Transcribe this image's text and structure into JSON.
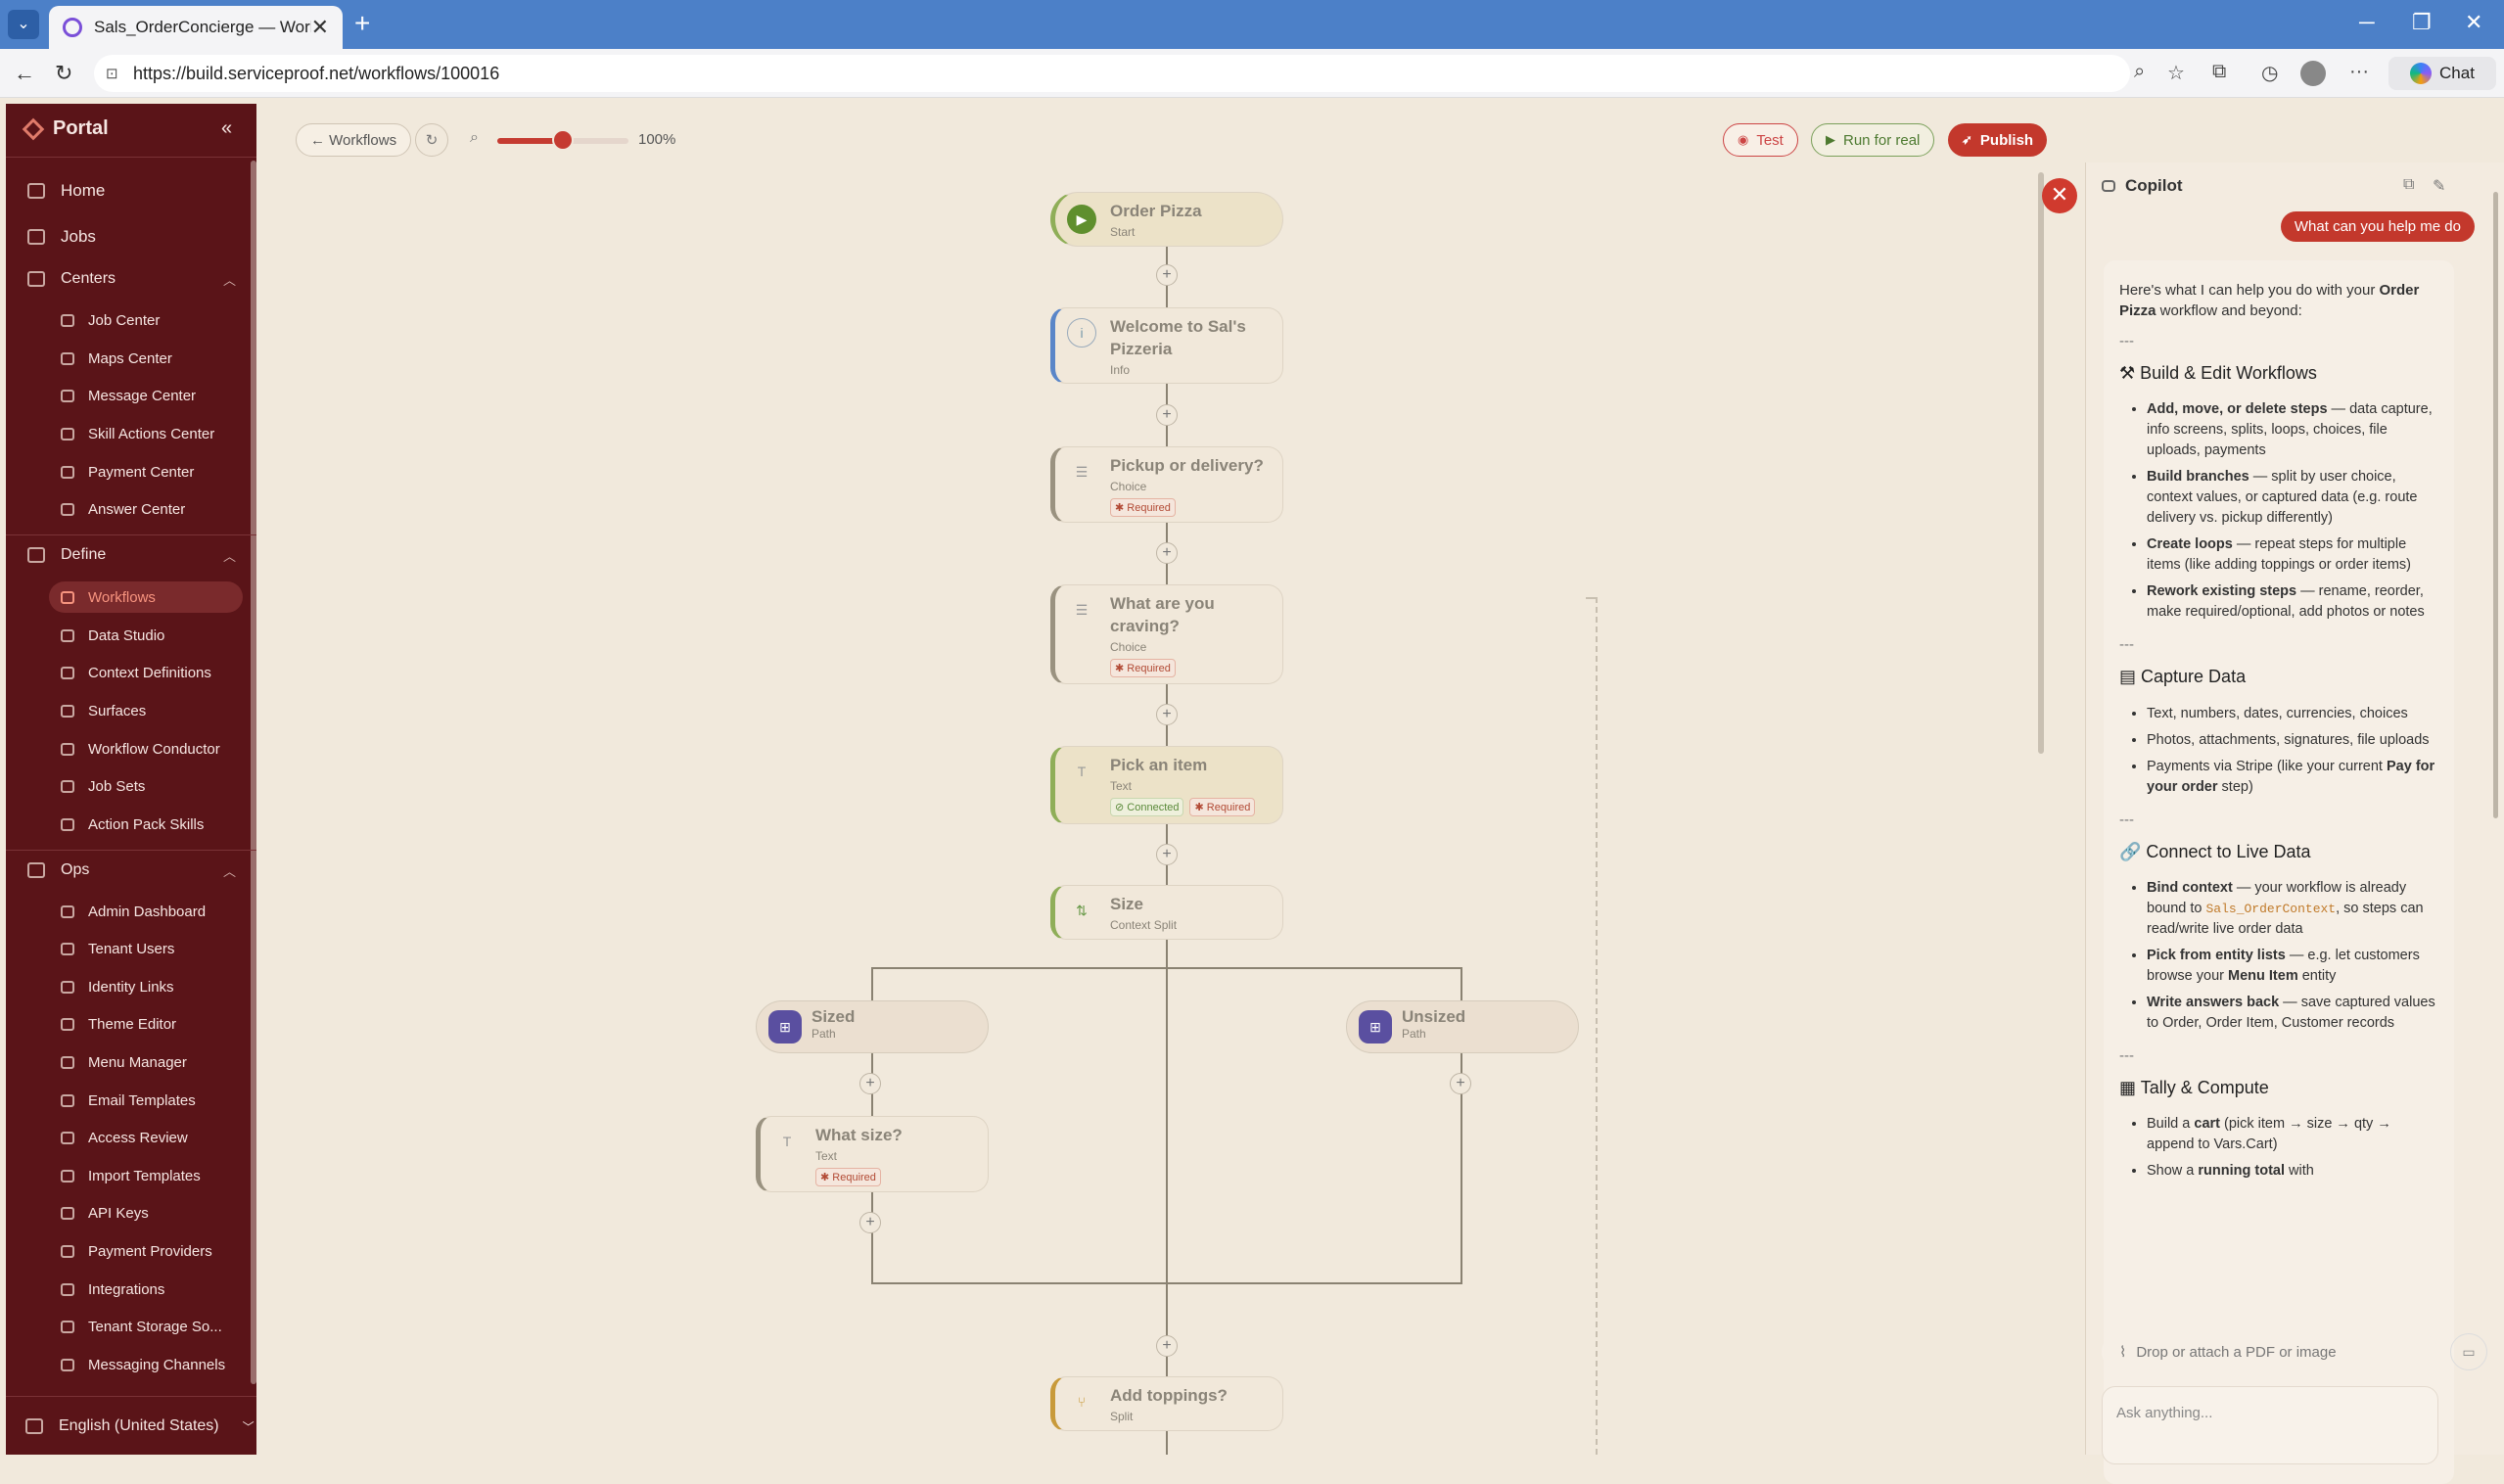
{
  "browser": {
    "tab_title": "Sals_OrderConcierge — Workflow",
    "url": "https://build.serviceproof.net/workflows/100016",
    "chat_label": "Chat"
  },
  "sidebar": {
    "brand": "Portal",
    "top_items": [
      {
        "label": "Home",
        "icon": "home-icon"
      },
      {
        "label": "Jobs",
        "icon": "briefcase-icon"
      }
    ],
    "sections": [
      {
        "label": "Centers",
        "icon": "grid-icon",
        "items": [
          "Job Center",
          "Maps Center",
          "Message Center",
          "Skill Actions Center",
          "Payment Center",
          "Answer Center"
        ]
      },
      {
        "label": "Define",
        "icon": "edit-icon",
        "items": [
          "Workflows",
          "Data Studio",
          "Context Definitions",
          "Surfaces",
          "Workflow Conductor",
          "Job Sets",
          "Action Pack Skills"
        ]
      },
      {
        "label": "Ops",
        "icon": "gear-icon",
        "items": [
          "Admin Dashboard",
          "Tenant Users",
          "Identity Links",
          "Theme Editor",
          "Menu Manager",
          "Email Templates",
          "Access Review",
          "Import Templates",
          "API Keys",
          "Payment Providers",
          "Integrations",
          "Tenant Storage So...",
          "Messaging Channels"
        ]
      }
    ],
    "active_item": "Workflows",
    "language": "English (United States)"
  },
  "toolbar": {
    "back_label": "← Workflows",
    "zoom_value": "100%",
    "zoom_fraction": 0.5,
    "test_label": "Test",
    "run_label": "Run for real",
    "publish_label": "Publish"
  },
  "flow": {
    "nodes": [
      {
        "title": "Order Pizza",
        "subtitle": "Start",
        "icon": "play-icon",
        "color": "#5f8f2e"
      },
      {
        "title": "Welcome to Sal's Pizzeria",
        "subtitle": "Info",
        "icon": "info-icon",
        "color": "#5a86c8"
      },
      {
        "title": "Pickup or delivery?",
        "subtitle": "Choice",
        "icon": "list-icon",
        "badges": [
          "Required"
        ]
      },
      {
        "title": "What are you craving?",
        "subtitle": "Choice",
        "icon": "list-icon",
        "badges": [
          "Required"
        ]
      },
      {
        "title": "Pick an item",
        "subtitle": "Text",
        "icon": "text-icon",
        "badges": [
          "Connected",
          "Required"
        ]
      },
      {
        "title": "Size",
        "subtitle": "Context Split",
        "icon": "split-icon"
      },
      {
        "title": "What size?",
        "subtitle": "Text",
        "icon": "text-icon",
        "badges": [
          "Required"
        ]
      },
      {
        "title": "Add toppings?",
        "subtitle": "Split",
        "icon": "split-icon"
      }
    ],
    "paths": [
      {
        "title": "Sized",
        "subtitle": "Path"
      },
      {
        "title": "Unsized",
        "subtitle": "Path"
      }
    ],
    "plus_label": "+"
  },
  "copilot": {
    "title": "Copilot",
    "user_message": "What can you help me do",
    "reply": {
      "intro_pre": "Here's what I can help you do with your ",
      "intro_bold": "Order Pizza",
      "intro_post": " workflow and beyond:",
      "separator": "---",
      "build_title": "Build & Edit Workflows",
      "build_items": [
        {
          "b": "Add, move, or delete steps",
          "t": " — data capture, info screens, splits, loops, choices, file uploads, payments"
        },
        {
          "b": "Build branches",
          "t": " — split by user choice, context values, or captured data (e.g. route delivery vs. pickup differently)"
        },
        {
          "b": "Create loops",
          "t": " — repeat steps for multiple items (like adding toppings or order items)"
        },
        {
          "b": "Rework existing steps",
          "t": " — rename, reorder, make required/optional, add photos or notes"
        }
      ],
      "capture_title": "Capture Data",
      "capture_items": [
        "Text, numbers, dates, currencies, choices",
        "Photos, attachments, signatures, file uploads"
      ],
      "capture_pay_pre": "Payments via Stripe (like your current ",
      "capture_pay_bold": "Pay for your order",
      "capture_pay_post": " step)",
      "connect_title": "Connect to Live Data",
      "bind_b": "Bind context",
      "bind_pre": " — your workflow is already bound to ",
      "bind_code": "Sals_OrderContext",
      "bind_post": ", so steps can read/write live order data",
      "pick_b": "Pick from entity lists",
      "pick_pre": " — e.g. let customers browse your ",
      "pick_bold2": "Menu Item",
      "pick_post": " entity",
      "write_b": "Write answers back",
      "write_t": " — save captured values to Order, Order Item, Customer records",
      "tally_title": "Tally & Compute",
      "cart_pre": "Build a ",
      "cart_b": "cart",
      "cart_post": " (pick item → size → qty → append to Vars.Cart)",
      "total_pre": "Show a ",
      "total_b": "running total",
      "total_post": " with"
    },
    "attach_placeholder": "Drop or attach a PDF or image",
    "ask_placeholder": "Ask anything..."
  },
  "colors": {
    "accent": "#c3382c",
    "sidebar": "#5a1418",
    "canvas": "#f1e9dc"
  }
}
